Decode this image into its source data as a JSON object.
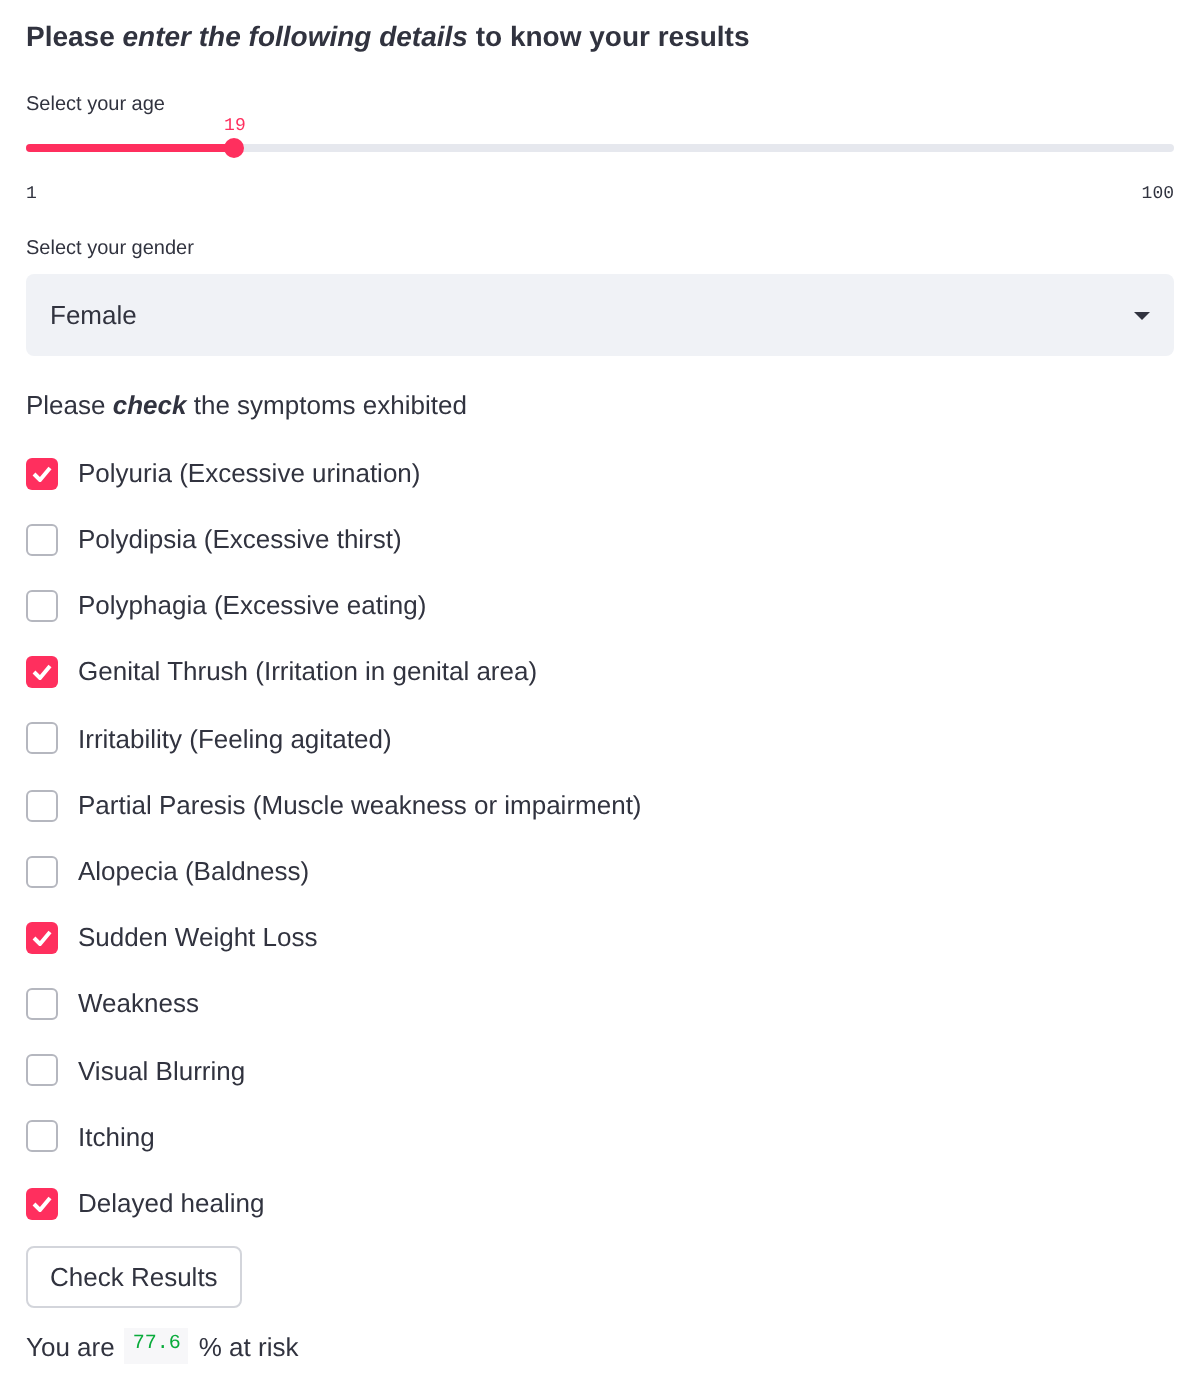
{
  "heading": "Please *enter the following details* to know your results",
  "age_slider": {
    "label": "Select your age",
    "value": "19",
    "level": 0.182,
    "min": "1",
    "max": "100"
  },
  "gender_select": {
    "label": "Select your gender",
    "value": "Female"
  },
  "symptoms_prompt": "Please *check* the symptoms exhibited",
  "symptoms": [
    {
      "label": "Polyuria (Excessive urination)",
      "checked": true
    },
    {
      "label": "Polydipsia (Excessive thirst)",
      "checked": false
    },
    {
      "label": "Polyphagia (Excessive eating)",
      "checked": false
    },
    {
      "label": "Genital Thrush (Irritation in genital area)",
      "checked": true
    },
    {
      "label": "Irritability (Feeling agitated)",
      "checked": false
    },
    {
      "label": "Partial Paresis (Muscle weakness or impairment)",
      "checked": false
    },
    {
      "label": "Alopecia (Baldness)",
      "checked": false
    },
    {
      "label": "Sudden Weight Loss",
      "checked": true
    },
    {
      "label": "Weakness",
      "checked": false
    },
    {
      "label": "Visual Blurring",
      "checked": false
    },
    {
      "label": "Itching",
      "checked": false
    },
    {
      "label": "Delayed healing",
      "checked": true
    }
  ],
  "check_button": "Check Results",
  "result": {
    "prefix": "You are",
    "value": "77.6",
    "suffix": "% at risk"
  }
}
